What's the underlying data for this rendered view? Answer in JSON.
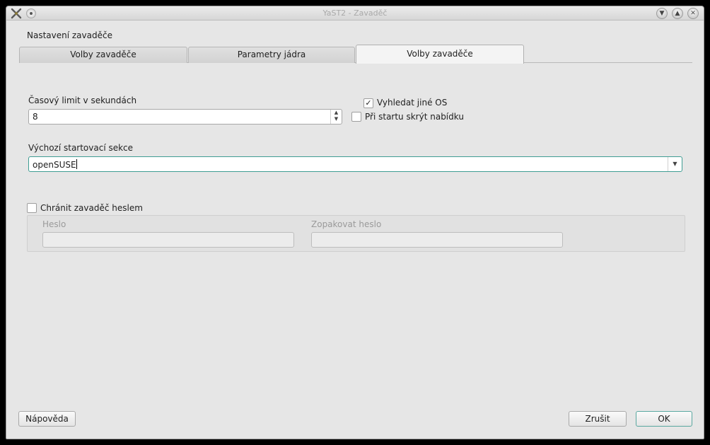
{
  "window": {
    "title": "YaST2 - Zavaděč"
  },
  "dialog": {
    "heading": "Nastavení zavaděče"
  },
  "tabs": [
    {
      "label": "Volby zavaděče",
      "active": false
    },
    {
      "label": "Parametry jádra",
      "active": false
    },
    {
      "label": "Volby zavaděče",
      "active": true
    }
  ],
  "timeout": {
    "label": "Časový limit v sekundách",
    "value": "8"
  },
  "options": {
    "probe_os_label": "Vyhledat jiné OS",
    "probe_os_checked": true,
    "hide_menu_label": "Při startu skrýt nabídku",
    "hide_menu_checked": false
  },
  "default_section": {
    "label": "Výchozí startovací sekce",
    "value": "openSUSE"
  },
  "password": {
    "protect_label": "Chránit zavaděč heslem",
    "protect_checked": false,
    "password_label": "Heslo",
    "repeat_label": "Zopakovat heslo"
  },
  "buttons": {
    "help": "Nápověda",
    "cancel": "Zrušit",
    "ok": "OK"
  },
  "colors": {
    "accent": "#3f9d93",
    "background": "#e6e6e6"
  }
}
